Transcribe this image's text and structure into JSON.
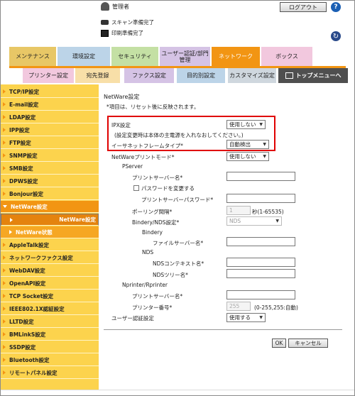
{
  "header": {
    "user": "管理者",
    "logout": "ログアウト",
    "help": "?",
    "scan_status": "スキャン準備完了",
    "print_status": "印刷準備完了"
  },
  "tabs": [
    {
      "label": "メンテナンス"
    },
    {
      "label": "環境設定"
    },
    {
      "label": "セキュリティ"
    },
    {
      "label": "ユーザー認証/部門管理"
    },
    {
      "label": "ネットワーク"
    },
    {
      "label": "ボックス"
    }
  ],
  "subtabs": [
    {
      "label": "プリンター設定"
    },
    {
      "label": "宛先登録"
    },
    {
      "label": "ファクス設定"
    },
    {
      "label": "目的別設定"
    },
    {
      "label": "カスタマイズ設定"
    },
    {
      "label": "トップメニューへ"
    }
  ],
  "sidebar": [
    {
      "label": "TCP/IP設定"
    },
    {
      "label": "E-mail設定"
    },
    {
      "label": "LDAP設定"
    },
    {
      "label": "IPP設定"
    },
    {
      "label": "FTP設定"
    },
    {
      "label": "SNMP設定"
    },
    {
      "label": "SMB設定"
    },
    {
      "label": "DPWS設定"
    },
    {
      "label": "Bonjour設定"
    },
    {
      "label": "NetWare設定"
    },
    {
      "label": "NetWare設定"
    },
    {
      "label": "NetWare状態"
    },
    {
      "label": "AppleTalk設定"
    },
    {
      "label": "ネットワークファクス設定"
    },
    {
      "label": "WebDAV設定"
    },
    {
      "label": "OpenAPI設定"
    },
    {
      "label": "TCP Socket設定"
    },
    {
      "label": "IEEE802.1X認証設定"
    },
    {
      "label": "LLTD設定"
    },
    {
      "label": "BMLinkS設定"
    },
    {
      "label": "SSDP設定"
    },
    {
      "label": "Bluetooth設定"
    },
    {
      "label": "リモートパネル設定"
    }
  ],
  "main": {
    "title": "NetWare設定",
    "note": "*項目は、リセット後に反映されます。",
    "ipx_label": "IPX設定",
    "ipx_value": "使用しない",
    "ipx_note": "(設定変更時は本体の主電源を入れなおしてください。)",
    "frame_label": "イーサネットフレームタイプ*",
    "frame_value": "自動検出",
    "print_mode_label": "NetWareプリントモード*",
    "print_mode_value": "使用しない",
    "pserver_label": "PServer",
    "print_server_name_label": "プリントサーバー名*",
    "change_password_label": "パスワードを変更する",
    "print_server_password_label": "プリントサーバーパスワード*",
    "polling_label": "ポーリング間隔*",
    "polling_value": "1",
    "polling_unit": "秒(1-65535)",
    "bindery_nds_label": "Bindery/NDS設定*",
    "bindery_nds_value": "NDS",
    "bindery_label": "Bindery",
    "file_server_label": "ファイルサーバー名*",
    "nds_label": "NDS",
    "nds_context_label": "NDSコンテキスト名*",
    "nds_tree_label": "NDSツリー名*",
    "nprinter_label": "Nprinter/Rprinter",
    "nprinter_server_label": "プリントサーバー名*",
    "printer_number_label": "プリンター番号*",
    "printer_number_value": "255",
    "printer_number_hint": "(0-255,255:自動)",
    "user_auth_label": "ユーザー認証設定",
    "user_auth_value": "使用する",
    "ok": "OK",
    "cancel": "キャンセル"
  }
}
